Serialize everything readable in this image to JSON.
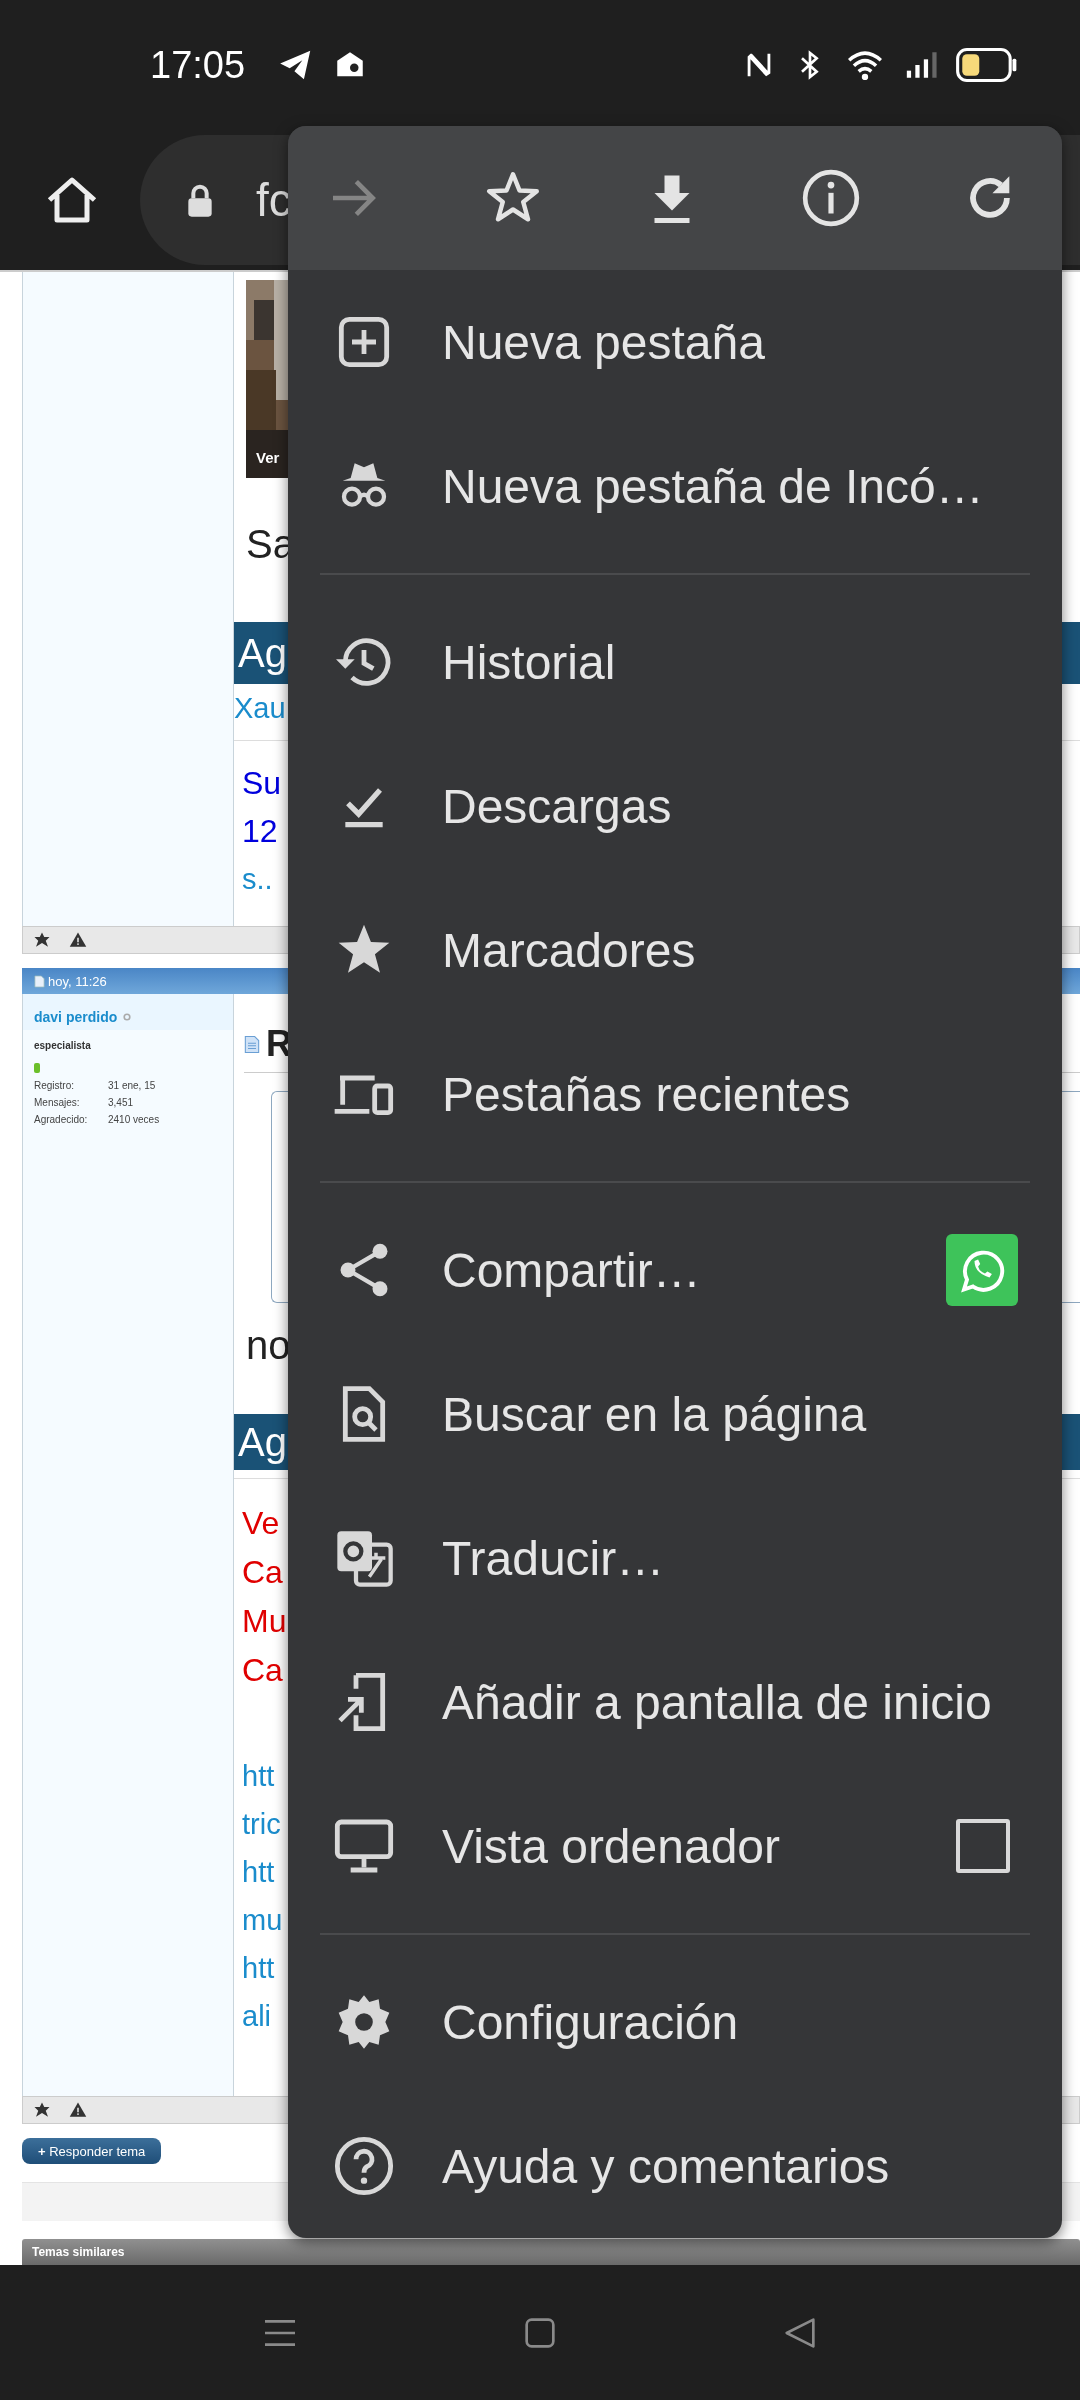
{
  "status_bar": {
    "time": "17:05"
  },
  "toolbar": {
    "address": "fc"
  },
  "page": {
    "post_1": {
      "image_caption": "Ver",
      "text": "Sa",
      "bar": "Ag",
      "link": "Xau",
      "blue_lines": [
        "Su",
        "12"
      ],
      "link_tail": "s.."
    },
    "post_2": {
      "time": "hoy, 11:26",
      "author": "davi perdido",
      "rank": "especialista",
      "stats": [
        {
          "label": "Registro:",
          "value": "31 ene, 15"
        },
        {
          "label": "Mensajes:",
          "value": "3,451"
        },
        {
          "label": "Agradecido:",
          "value": "2410 veces"
        }
      ],
      "title": "R",
      "text": "no",
      "bar": "Ag",
      "red_lines": [
        "Ve",
        "Ca",
        "Mu",
        "Ca"
      ],
      "link_lines": [
        "htt",
        "tric",
        "htt",
        "mu",
        "htt",
        "ali"
      ]
    },
    "reply_button": "**+** Responder tema",
    "similar_topics": "Temas similares"
  },
  "menu": {
    "toolbar": [
      {
        "kind": "forward",
        "disabled": true
      },
      {
        "kind": "bookmark",
        "disabled": false
      },
      {
        "kind": "download",
        "disabled": false
      },
      {
        "kind": "info",
        "disabled": false
      },
      {
        "kind": "refresh",
        "disabled": false
      }
    ],
    "sections": [
      [
        {
          "kind": "new-tab",
          "label": "Nueva pestaña"
        },
        {
          "kind": "incognito",
          "label": "Nueva pestaña de Incó…"
        }
      ],
      [
        {
          "kind": "history",
          "label": "Historial"
        },
        {
          "kind": "downloads",
          "label": "Descargas"
        },
        {
          "kind": "bookmarks",
          "label": "Marcadores"
        },
        {
          "kind": "recent-tabs",
          "label": "Pestañas recientes"
        }
      ],
      [
        {
          "kind": "share",
          "label": "Compartir…"
        },
        {
          "kind": "find",
          "label": "Buscar en la página"
        },
        {
          "kind": "translate",
          "label": "Traducir…"
        },
        {
          "kind": "add-home",
          "label": "Añadir a pantalla de inicio"
        },
        {
          "kind": "desktop",
          "label": "Vista ordenador",
          "checked": false
        }
      ],
      [
        {
          "kind": "settings",
          "label": "Configuración"
        },
        {
          "kind": "help",
          "label": "Ayuda y comentarios"
        }
      ]
    ]
  }
}
